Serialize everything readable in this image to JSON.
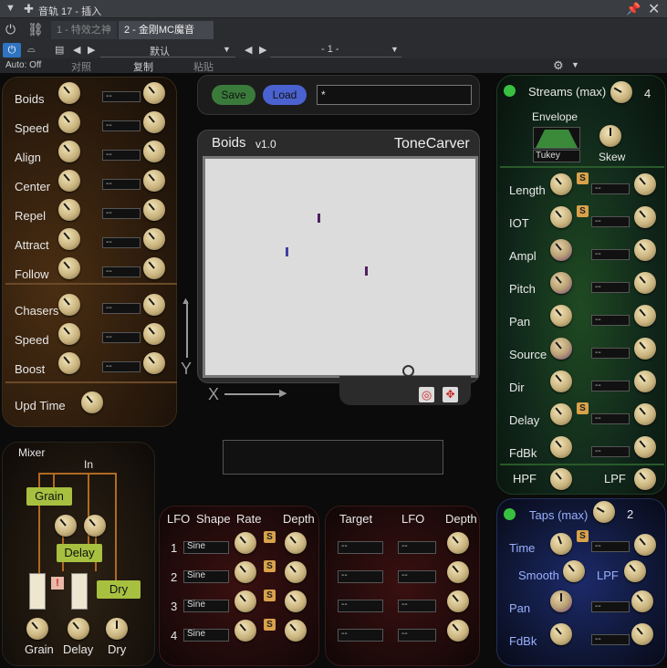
{
  "titlebar": {
    "title": "音轨 17 - 插入"
  },
  "plugin_tabs": [
    "1 - 特效之神",
    "2 - 金刚MC魔音"
  ],
  "toolbar": {
    "auto": "Auto: Off",
    "compare": "对照",
    "copy": "复制",
    "paste": "粘贴",
    "preset": "默认",
    "page": "- 1 -"
  },
  "boids": {
    "labels": [
      "Boids",
      "Speed",
      "Align",
      "Center",
      "Repel",
      "Attract",
      "Follow"
    ],
    "chaser_labels": [
      "Chasers",
      "Speed",
      "Boost"
    ],
    "upd": "Upd Time",
    "box_value": "--"
  },
  "header": {
    "save": "Save",
    "load": "Load",
    "name": "*"
  },
  "display": {
    "title": "Boids",
    "version": "v1.0",
    "brand": "ToneCarver",
    "y_axis": "Y",
    "x_axis": "X"
  },
  "streams": {
    "title": "Streams (max)",
    "count": "4",
    "envelope": "Envelope",
    "env_type": "Tukey",
    "skew": "Skew",
    "labels": [
      "Length",
      "IOT",
      "Ampl",
      "Pitch",
      "Pan",
      "Source",
      "Dir",
      "Delay",
      "FdBk"
    ],
    "hpf": "HPF",
    "lpf": "LPF",
    "s": "S"
  },
  "taps": {
    "title": "Taps (max)",
    "count": "2",
    "time": "Time",
    "smooth": "Smooth",
    "lpf": "LPF",
    "pan": "Pan",
    "fdbk": "FdBk"
  },
  "mixer": {
    "title": "Mixer",
    "in": "In",
    "grain": "Grain",
    "delay": "Delay",
    "dry": "Dry",
    "warn": "!"
  },
  "lfo": {
    "headers": [
      "LFO",
      "Shape",
      "Rate",
      "Depth"
    ],
    "rows": [
      "1",
      "2",
      "3",
      "4"
    ],
    "shape": "Sine"
  },
  "target": {
    "headers": [
      "Target",
      "LFO",
      "Depth"
    ]
  },
  "colors": {
    "stream_green": "#1f7a2a",
    "taps_blue": "#1b2a7a",
    "boid_brown": "#3a2410",
    "lfo_red": "#3a1010"
  }
}
